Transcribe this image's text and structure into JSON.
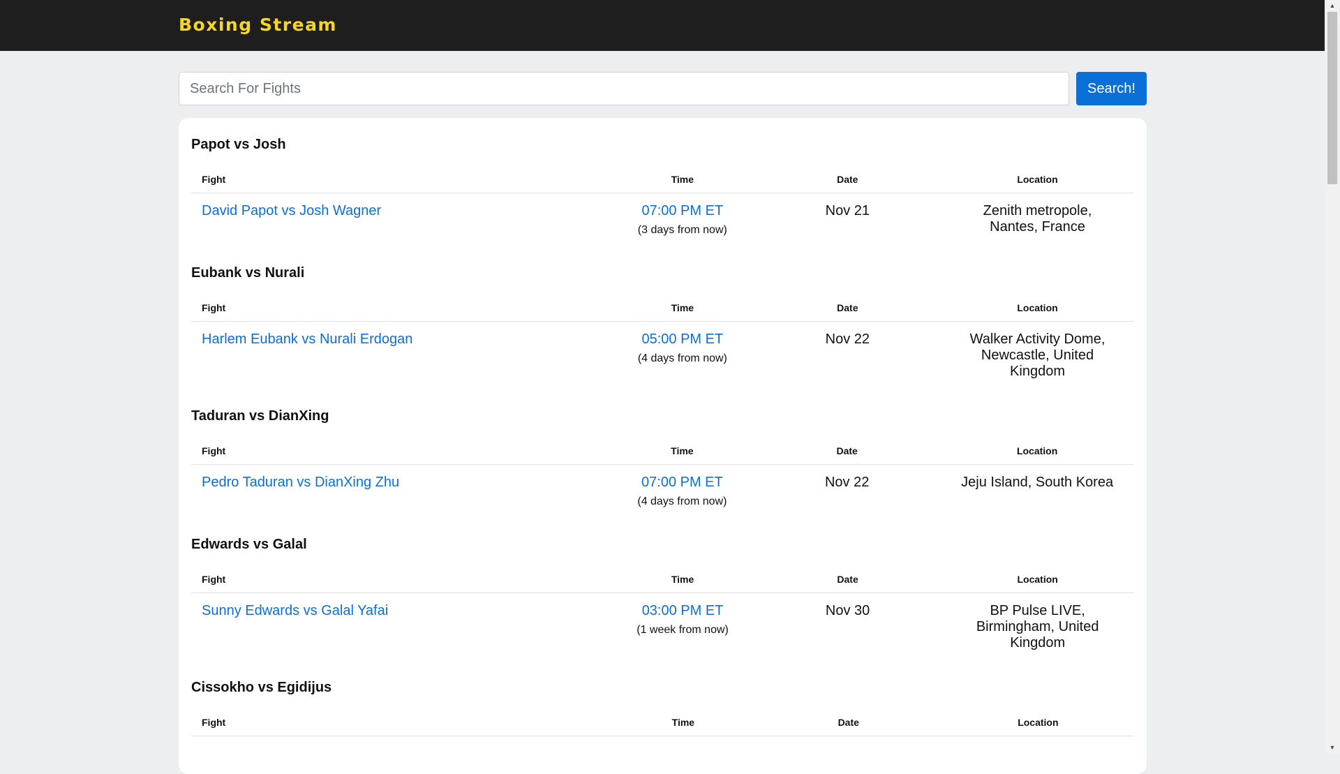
{
  "navbar": {
    "brand": "Boxing Stream",
    "brand_color": "#f5d623",
    "background": "#1e1e1e"
  },
  "search": {
    "placeholder": "Search For Fights",
    "value": "",
    "button_label": "Search!"
  },
  "table_headers": {
    "fight": "Fight",
    "time": "Time",
    "date": "Date",
    "location": "Location"
  },
  "events": [
    {
      "title": "Papot vs Josh",
      "fight": "David Papot vs Josh Wagner",
      "time": "07:00 PM ET",
      "relative": "(3 days from now)",
      "date": "Nov 21",
      "location": "Zenith metropole, Nantes, France"
    },
    {
      "title": "Eubank vs Nurali",
      "fight": "Harlem Eubank vs Nurali Erdogan",
      "time": "05:00 PM ET",
      "relative": "(4 days from now)",
      "date": "Nov 22",
      "location": "Walker Activity Dome, Newcastle, United Kingdom"
    },
    {
      "title": "Taduran vs DianXing",
      "fight": "Pedro Taduran vs DianXing Zhu",
      "time": "07:00 PM ET",
      "relative": "(4 days from now)",
      "date": "Nov 22",
      "location": "Jeju Island, South Korea"
    },
    {
      "title": "Edwards vs Galal",
      "fight": "Sunny Edwards vs Galal Yafai",
      "time": "03:00 PM ET",
      "relative": "(1 week from now)",
      "date": "Nov 30",
      "location": "BP Pulse LIVE, Birmingham, United Kingdom"
    },
    {
      "title": "Cissokho vs Egidijus",
      "fight": "",
      "time": "",
      "relative": "",
      "date": "",
      "location": ""
    }
  ],
  "colors": {
    "link": "#0b6fd8",
    "page_bg": "#eceef0",
    "button_bg": "#0b6fd8"
  },
  "icons": [
    "scroll-up-arrow-icon",
    "scroll-down-arrow-icon"
  ]
}
